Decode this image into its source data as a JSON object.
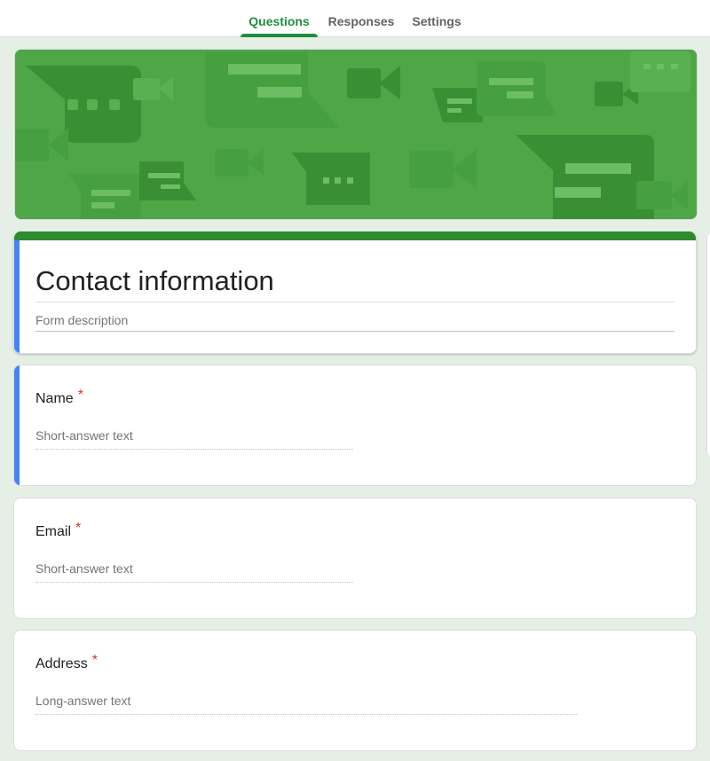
{
  "tabs": [
    {
      "label": "Questions",
      "active": true
    },
    {
      "label": "Responses",
      "active": false
    },
    {
      "label": "Settings",
      "active": false
    }
  ],
  "form": {
    "title": "Contact information",
    "description_placeholder": "Form description",
    "theme_color": "#2e8b2e",
    "banner_color": "#4ea646"
  },
  "questions": [
    {
      "label": "Name",
      "required_mark": "*",
      "answer_placeholder": "Short-answer text",
      "type": "short"
    },
    {
      "label": "Email",
      "required_mark": "*",
      "answer_placeholder": "Short-answer text",
      "type": "short"
    },
    {
      "label": "Address",
      "required_mark": "*",
      "answer_placeholder": "Long-answer text",
      "type": "long"
    }
  ],
  "colors": {
    "accent": "#1e8e3e",
    "focus_bar": "#4285f4",
    "required": "#d93025",
    "background": "#e6efe6"
  }
}
